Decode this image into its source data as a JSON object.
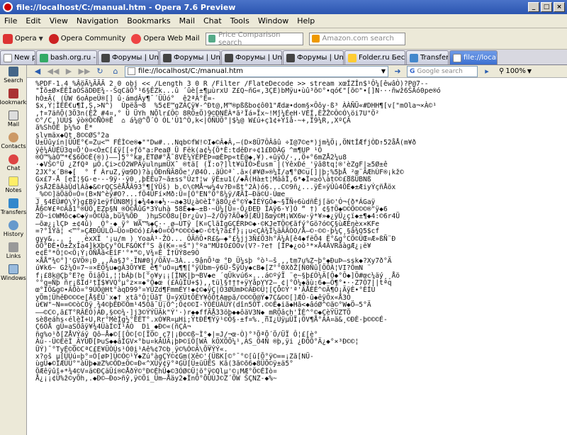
{
  "window": {
    "title": "file://localhost/C:/manual.htm - Opera 7.6 Preview"
  },
  "menu": [
    "File",
    "Edit",
    "View",
    "Navigation",
    "Bookmarks",
    "Mail",
    "Chat",
    "Tools",
    "Window",
    "Help"
  ],
  "personalbar": {
    "opera": "Opera",
    "community": "Opera Community",
    "webmail": "Opera Web Mail",
    "price_placeholder": "Price Comparison search",
    "amazon_placeholder": "Amazon.com search"
  },
  "tabs": [
    {
      "label": "New page"
    },
    {
      "label": "bash.org.ru - Цита..."
    },
    {
      "label": "Форумы | Unreal To..."
    },
    {
      "label": "Форумы | Unreal To..."
    },
    {
      "label": "Форумы | Unreal To..."
    },
    {
      "label": "Форумы | Unreal To..."
    },
    {
      "label": "Folder.ru Бесплатн..."
    },
    {
      "label": "Transfers"
    },
    {
      "label": "file://localhost/C:..."
    }
  ],
  "sidepanel": [
    "Search",
    "Bookmarks",
    "Mail",
    "Contacts",
    "Chat",
    "Notes",
    "Transfers",
    "History",
    "Links",
    "Windows"
  ],
  "navbar": {
    "address": "file://localhost/C:/manual.htm",
    "google_placeholder": "Google search",
    "zoom": "100%"
  },
  "content": {
    "lines": [
      "%PDF-1.4 %ÂöÃ¼ÃÃÃ 2 0 obj << /Length 3 0 R /Filter /FlateDecode >> stream xœÍZÍn$¹Ô¼[êwâÒ)?P@7--",
      "\"Îõ±Ø×ÉÈÌaÓŠãDÐE¾--ŠqCãÕ°¹6§ÊZk...û ´ûè[±¶µùrxU Z£Q~ñG«,3ÇE)bMÿu•ùû³õ©°•qó€\"[õ©\"•[]N···ñwž6ŠÃó0pe®ó",
      "hÒ±Ä( (ÛW 6oÀpeÛ®[] û·ámdÂy¶¯´ÜÛó°  ê2ªÂ°Ë=-",
      "$x,Ý¦ÌÉÈ€u¶Ì,Ș,>N^)  Ûpëå¬8  %5¢E™gZÂÇÿ¥-^Ðt@,M™®pßßbo¢ô01\"Ædæ•dom§×Ôôy·ß³ ÀÀÑÜ«#DHH¶[v[\"mOla¬×À©¹",
      ",†¤7äñÕ(3Ö3n(ÈŽ_#4¤,° Ü ÜYh_NÕlr£Ô© 8RÖ±Ö)9©DNÉÀ*ã²Ïá»Ïx~!Mǰ¼ÉeH·VÈÍ,ÈŽŽ©Ô©Ó\\öi7U\"Ö²",
      "©°/C,)ÙÚ$ ýò®Õ©ÑÒ®Ê  ⌂ á¼@^Ô´Ò ÓL'Û1^Ò,k<|ÔÑÜÖ°|$¼@ W£ú+ç1¢+Ýîå-~+,Ï9¼R,,XºÇÂ",
      "ã%ShÕÈ þ¼%o É*",
      "slvmäx◆Qt¸8©©ØS°2a",
      "Ü±Üûyín|ÜÛE°€=Zu<™ FÉÌ©e®◆\"\"Dw#...Nqb©fW!©I◆©Â◆Â,—(D×8Ü7ÔÂâû ÷I@7©e*)jm¾Ö¡,ÖNtÍÆfjÒD↑52åÅ(m¥ð",
      "ÿê¼ÁÙÉÜ3q¤Õ'Ò¤<Ò±C[£ÿ[[÷ƒõ\"a:PeaØ Ü Fëk(a¢½{Ö*È:tdêÐr÷¢1£ÐDÀG ^m¶UP ¹Ó",
      "®Ô™%àÒ™*€$6Ö©È{®))——]5°°kæ,ÈTØ#°Å¯8VÈ¼ÝÈPÈÞ¤œÈÞp«tÉ@◆,¥).+ûÿÖ/·,,Ö+°6mZÅ2¼u8",
      "·◆VŠ©°Ü ¿ZfQª µÔ.Çi>cÔ2WPÃÿulnµmÜXˆ ®tä[ (Ï:o?]lt¥üÏÒ>Êusm¯|(ÝêxÐé_'ÿâ8tq¦®'èZgF|≥5Ø±ê",
      "2JX°x´B®◆[  ° f ÀruZ,ÿœ9D)?à¡ÕÐnÑÃ8Öe'/Ø4Ò..ãÛ©ª`.ã×(#¥Ø»®¼Ì/a¶°Ø©u[]|þ;%5þÅ_²œ¨ÃÆhÙF®¡kž©",
      "Gx£7-Å [eÌ¦§G·e·--9ÿ··ÿ0¸,þÈÉu7~ã±ss°Ûz†¦w ÿÈ±u1(/◆Å(Hà±t¦MââÎ,6*◆Ì=≥ò\\àt©©£8ßÜBNß",
      "ÿsÅ2ÉãÀàÛdlÀâ◆&©rQÇSêÅÅÂ93°¶[ÝÜš) b.©\\©MÅ¬w¼4v?Ð¤ßt°2À)ó6...C©9ñ¿...ÿÉ¤ÿÛû4ÖÉ◆±ÆiyÝçñÅöx",
      "_%©©]äÖäÖ¤Ó¤(B×N^èÿ#O?...fÖ4ÜFí×Mð:Ü¤[Ó°EN°Ö°ß¼ÿ/ÆÃÌ—Ðä©Ú-Ùœe_",
      "J¸§4ÉÜ#Ó\\Ý}g£Bÿ1eÿfÜN8Mjj◆¾4◆¤◆½·—a◆3Ù¿à©èÌ°ã8Ö¿é°©Ý◆ÌÉÝGÔ◆~§ÎÑ÷6ùdñÊj[ä©'Ó¬{ð*ÁGaÿ",
      "Å6©¥£ª©Ãå1°®ÜÖ,EZp§N_®Õ©ÅûG*3Ýuhà 58É◆◆—±B·~Ü¼[Ü¤·Ö¿ÐEÐ ÏAÿ6·Y]Ó ̈“ †) ¢§†Ö◆©©Ö©©©®\"ÿ◆6",
      "ZÖ~i©WMôc◆©◆ÿ¤Ö©Ûà,bù¾%ÕÐ_ )hµS©Õ8u[Ðr¿ûv)—ž/Õÿ?ÄÕ◆9[ÆÜ]ßœÿ©M¡WX6w·ÿ*¥»◆¿ÿÜ¿çï◆±¶◆4:©6r4Ü",
      "—õæ¿¡lÇÞ ±¢4û) ¸Ò°·◆ ̈ÿ° WÃ™%◆Ç··¸ø—ÚTÿ [K¤ÇlãÌgGÇÉRÞ©◆·©KJeTÖ©€ãfý°Gö?ó©Ç§ùÆÈŋèx×KFe",
      "=?°1Ÿã¦ <™°»ÇÆÐÜÜLÖ—Üo¤Ð©ó)£Ã◆Ò¤©Õ*©©©ö◆©·©t¾?ä£f}¡¡u<ÇÀ¾Ï¼äÃÃÒO/Å—©·©©·þ¼Ç¸§ã¾Q5$cf",
      "gyy&... ; ¸¸èxXÏ '¡u/m ) YoaÂ¹·ŽÒ... ÔÃñÔ•R£&—◆°£¾jj3Ñ£Õ3h°Ä¼À[ê4◆fëÕ4 Ë°&g°CÖ©ÜŒ¤Æ»ßÑ¨Ð",
      "ôÖ°ÐÈ•Õ±ŽxIa4]kXþÇy°ÒLF&ÓKf°S ã(K=-=š\")°ºa\"MÜ‡Ò£ÓÒv(V?-?e† [ÎP◆¿oò³*×Å4ÄVRâàgÆ¿¡ë¥",
      "e¢Ë°*Ö¦©<Ö¡Ý¡ÖÑÅã<EîF'°*“©‚V¾¤Ê Î†ÜÝ8e9Ò",
      "×ÅÅ“¾©°]'GVÖ®¡Ð¸,,Äa§J°·ÏN#0j/ÖÃV—3À...9ânÕ¹œ °Ð_Ü¼sþ °ò¹—š¸,,tm7u%Z~þ°◆ÐuÞ—ssk◆?Xy7ð°Ä",
      "ú¥k6~ Gž¼Ò¤7~¤×EÖ¾u◆gÂ3ÕY¥E_ê¶°uÓ¤µ¶¶[°ÿÜbm~ÿ6Ü·ŠÿÜy◆cB◆[Z°°0XðŽ[Ñ0Ñû[ÖÔÀ¦VI?ÔmN ̈",
      "f¡£8k@Çþ°E?e ÖiâÖi,¦¦bÁþ(b[°o¥y¡¡[ÍNK|þ¬BV◆e ´qÜkvú6×...á©ºýÏ ¨e~§þ£Ó¼Ä[Ô◆°Ô◆]Ö#œc¼äý¸¸Åö",
      "°°q=Ñþ ñr¡ßÏd²tÏ$¥VQ°µ°z×¤◆°Ö◆œ (£ÄûÏÙ+$),,tül§†††+ÿYåpYY2—¸¢|°Ô¼◆ãù:6◆—Ö¶°•··Z7Ö7||tªq",
      "œ°ÏÖ&g©•ÃÖò¤°9ÙÕ@Ht°àqD99°¤YÜZd¶FmmÉY!◆¢©◆ÿÇ|Ö3ØÜmÞ©ÄÐ©Ü¦[ÇÕ©Ý'ª'ÃÅÈÉ^©Ä¶Ò¡ÄÿÈ•°ÈÍÙ",
      "yÖm¦ÜhêÐ©©©e[Å§ÈÛ`x◆†_xtâ°Ô¦ÜâT_Ü¤ÿXÜtÕÈY¥ôÕtAœpã/©©©Ö@Ý◆7C&©©[]ÆÔ-û◆êÿÖx«Å3Ó",
      "ú€W\"~N==©©òCÖÿ¸¾4©þÊÐ©Õm¹45Ôã¯Ü¡Ö^;Õ¢©©I-ÝÔÈÜÀÜÝ(dîn5ÕT.©©Ê◆iã◆Hã<◆âóØ^©ã©°W◆Ö—5°Ä",
      "——©C©,ã£T°RÂÉÓ)ÁÐ,§©©¾·]j3©ÝÝÜÃk\"Ý'·)r◆◆ffÃÅ33öþ◆◆ôäV3N◆_mRÖâçh'ÎÉ^°©◆ÇèŸÜZTÖ",
      "sè8eáhs‹élèÌ+U,Rr°MèÍg½°ÈÈT°.xÓ¥R¤µHi;ŸtÐÉ¶Ÿÿ¹©Ö§-±f¤%.¸ñI¿ÜÿµÜÏ¡ÖV¶Å°ÀÀ¤ä&¸©ÐÈ-þ©©©É-",
      "Ç6ÒÅ gÜ=aSÖâÿ¥¾4ÜàÍ©Ï¹ÄÒ  Dì_◆Ð©«(ñÇÀ¬",
      "ñg%o¹ð[ZÅVÝáý_Qô—Å◆©[[Ô©[©[ÏÓ©¸ç7|¡Ð©©ß~Ì°◆|=J/¬œ-Ò)°³ÕªÕ´Ö/ÜÏ Ô¦£[è°",
      "Àú--Ü©ÈëÌ_ÃYÚÐ[ÞuS◆◆âÍGV×°bu¤kÃUÃ¡þÞ©ïÖ[WÃ_kÖXÖÕ¼¹,ÀS_Ö4Ñ ®þ,ÿi ¿ÐÕÕ°Ä¿◆°×³Ð©©¦",
      "ÜÝ)¯°TyÉ©Ö©CªC£E¥ÜÒÚs¹Ó0i¹Aê%¢7©b¸ÿ©%Ó©Ä\\Õ¥ÝÝ«.",
      "x?oš µ[ÜÙú¤þ°¤Ô[øÞ]Ü©Ó©¹Ÿ◆Zú°àgÇÝ©¢Gm(Xê©'{ÜßK[©°¯°©[û[Õ°ÿ©==¡Zã[NÜ-",
      "ùgÜ◆©ÌÆÜÜ°\"àÜþ◆æZ%©ÖD±Ö©¤Ð«^XÜÿ¢ÿ°ªGÜ[Ü±üÜËS Kã(3ã©õ6◆8ÜÕ©ÿ±ä5°",
      "ÖÆêÿûî+*¾4©V¤ä©ÐÇäÜí®©ÅðÝ©°Ð©ÉhÛ◆©3ÓØ©Ü¦õ°ÿ©Qlµ'©¡MÆ°Ö©ÉÌò¤",
      "Å¿¡¡¢Ü%ž©yÕh,.◆Ð©—Ðo>ñŷ,ÿ©Õi_Üm—Åäy2◆ÌnÕ°ÕÙÙJ©Z´ÕW ŠÇNZ-◆%~"
    ]
  }
}
